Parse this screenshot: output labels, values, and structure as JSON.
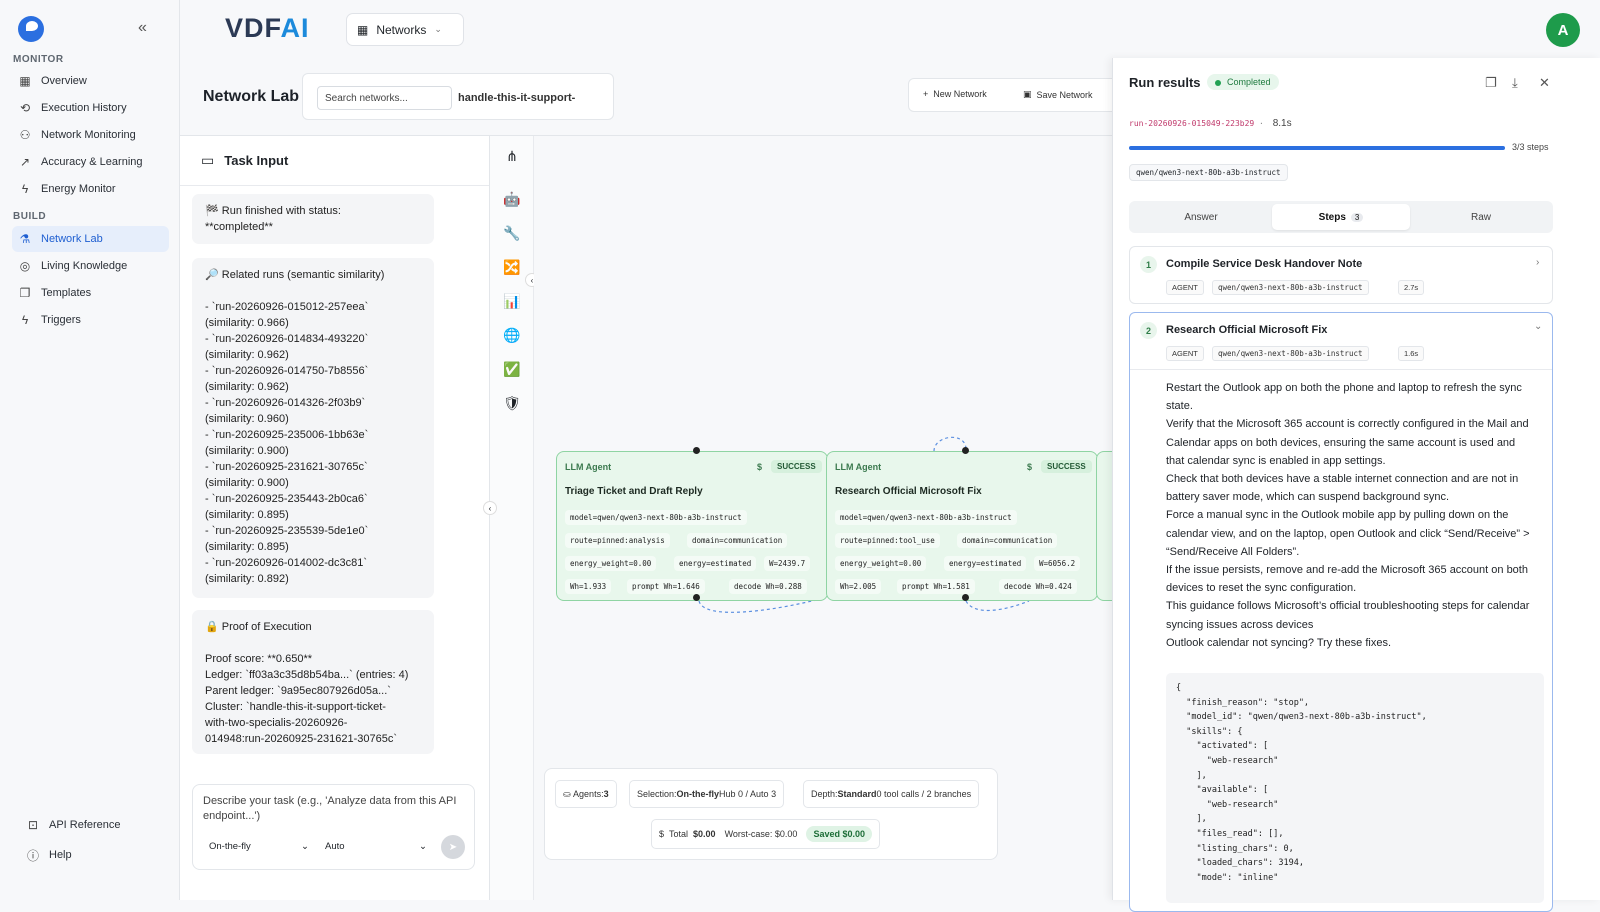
{
  "sidebar": {
    "monitor_label": "MONITOR",
    "build_label": "BUILD",
    "monitor_items": [
      {
        "label": "Overview",
        "icon": "grid-icon"
      },
      {
        "label": "Execution History",
        "icon": "history-icon"
      },
      {
        "label": "Network Monitoring",
        "icon": "network-icon"
      },
      {
        "label": "Accuracy & Learning",
        "icon": "trend-icon"
      },
      {
        "label": "Energy Monitor",
        "icon": "bolt-icon"
      }
    ],
    "build_items": [
      {
        "label": "Network Lab",
        "icon": "flask-icon",
        "active": true
      },
      {
        "label": "Living Knowledge",
        "icon": "brain-icon"
      },
      {
        "label": "Templates",
        "icon": "copy-icon"
      },
      {
        "label": "Triggers",
        "icon": "bolt-icon"
      }
    ],
    "footer": [
      {
        "label": "API Reference"
      },
      {
        "label": "Help"
      }
    ]
  },
  "topbar": {
    "brand_a": "VDF",
    "brand_b": "AI",
    "network_selector": "Networks",
    "avatar": "A"
  },
  "lab": {
    "title": "Network Lab",
    "search_placeholder": "Search networks...",
    "network_name": "handle-this-it-support-",
    "new_network": "New Network",
    "save_network": "Save Network"
  },
  "task": {
    "title": "Task Input",
    "card1": [
      "🏁 Run finished with status:",
      "**completed**"
    ],
    "card2": [
      "🔎 Related runs (semantic similarity)",
      "",
      "- `run-20260926-015012-257eea`",
      "(similarity: 0.966)",
      "- `run-20260926-014834-493220`",
      "(similarity: 0.962)",
      "- `run-20260926-014750-7b8556`",
      "(similarity: 0.962)",
      "- `run-20260926-014326-2f03b9`",
      "(similarity: 0.960)",
      "- `run-20260925-235006-1bb63e`",
      "(similarity: 0.900)",
      "- `run-20260925-231621-30765c`",
      "(similarity: 0.900)",
      "- `run-20260925-235443-2b0ca6`",
      "(similarity: 0.895)",
      "- `run-20260925-235539-5de1e0`",
      "(similarity: 0.895)",
      "- `run-20260926-014002-dc3c81`",
      "(similarity: 0.892)"
    ],
    "card3": [
      "🔒 Proof of Execution",
      "",
      "Proof score: **0.650**",
      "Ledger: `ff03a3c35d8b54ba...` (entries: 4)",
      "Parent ledger: `9a95ec807926d05a...`",
      "Cluster: `handle-this-it-support-ticket-",
      "with-two-specialis-20260926-",
      "014948:run-20260925-231621-30765c`"
    ],
    "composer_placeholder": "Describe your task (e.g., 'Analyze data from this API endpoint...')",
    "mode": "On-the-fly",
    "routing": "Auto"
  },
  "nodes": [
    {
      "type": "LLM Agent",
      "status": "SUCCESS",
      "title": "Triage Ticket and Draft Reply",
      "chips": [
        "model=qwen/qwen3-next-80b-a3b-instruct",
        "route=pinned:analysis",
        "domain=communication",
        "energy_weight=0.00",
        "energy=estimated",
        "W=2439.7",
        "Wh=1.933",
        "prompt Wh=1.646",
        "decode Wh=0.288"
      ]
    },
    {
      "type": "LLM Agent",
      "status": "SUCCESS",
      "title": "Research Official Microsoft Fix",
      "chips": [
        "model=qwen/qwen3-next-80b-a3b-instruct",
        "route=pinned:tool_use",
        "domain=communication",
        "energy_weight=0.00",
        "energy=estimated",
        "W=6056.2",
        "Wh=2.005",
        "prompt Wh=1.581",
        "decode Wh=0.424"
      ]
    }
  ],
  "stats": {
    "agents_label": "Agents:",
    "agents_value": "3",
    "selection_label": "Selection:",
    "selection_value": "On-the-fly",
    "selection_rest": "Hub 0 / Auto 3",
    "depth_label": "Depth:",
    "depth_value": "Standard",
    "depth_rest": "0 tool calls / 2 branches",
    "total_label": "Total",
    "total_value": "$0.00",
    "worst": "Worst-case: $0.00",
    "saved": "Saved $0.00"
  },
  "results": {
    "title": "Run results",
    "status": "Completed",
    "run_id": "run-20260926-015049-223b29",
    "duration": "8.1s",
    "steps_progress": "3/3 steps",
    "progress": 1.0,
    "model": "qwen/qwen3-next-80b-a3b-instruct",
    "tabs": [
      "Answer",
      "Steps",
      "Raw"
    ],
    "steps_count": "3",
    "step1": {
      "num": "1",
      "title": "Compile Service Desk Handover Note",
      "kind": "AGENT",
      "model": "qwen/qwen3-next-80b-a3b-instruct",
      "time": "2.7s"
    },
    "step2": {
      "num": "2",
      "title": "Research Official Microsoft Fix",
      "kind": "AGENT",
      "model": "qwen/qwen3-next-80b-a3b-instruct",
      "time": "1.6s"
    },
    "answer": [
      "Restart the Outlook app on both the phone and laptop to refresh the sync state.",
      "Verify that the Microsoft 365 account is correctly configured in the Mail and Calendar apps on both devices, ensuring the same account is used and that calendar sync is enabled in app settings.",
      "Check that both devices have a stable internet connection and are not in battery saver mode, which can suspend background sync.",
      "Force a manual sync in the Outlook mobile app by pulling down on the calendar view, and on the laptop, open Outlook and click “Send/Receive” > “Send/Receive All Folders”.",
      "If the issue persists, remove and re-add the Microsoft 365 account on both devices to reset the sync configuration.",
      "This guidance follows Microsoft’s official troubleshooting steps for calendar syncing issues across devices",
      "Outlook calendar not syncing? Try these fixes."
    ],
    "raw": "{\n  \"finish_reason\": \"stop\",\n  \"model_id\": \"qwen/qwen3-next-80b-a3b-instruct\",\n  \"skills\": {\n    \"activated\": [\n      \"web-research\"\n    ],\n    \"available\": [\n      \"web-research\"\n    ],\n    \"files_read\": [],\n    \"listing_chars\": 0,\n    \"loaded_chars\": 3194,\n    \"mode\": \"inline\""
  }
}
